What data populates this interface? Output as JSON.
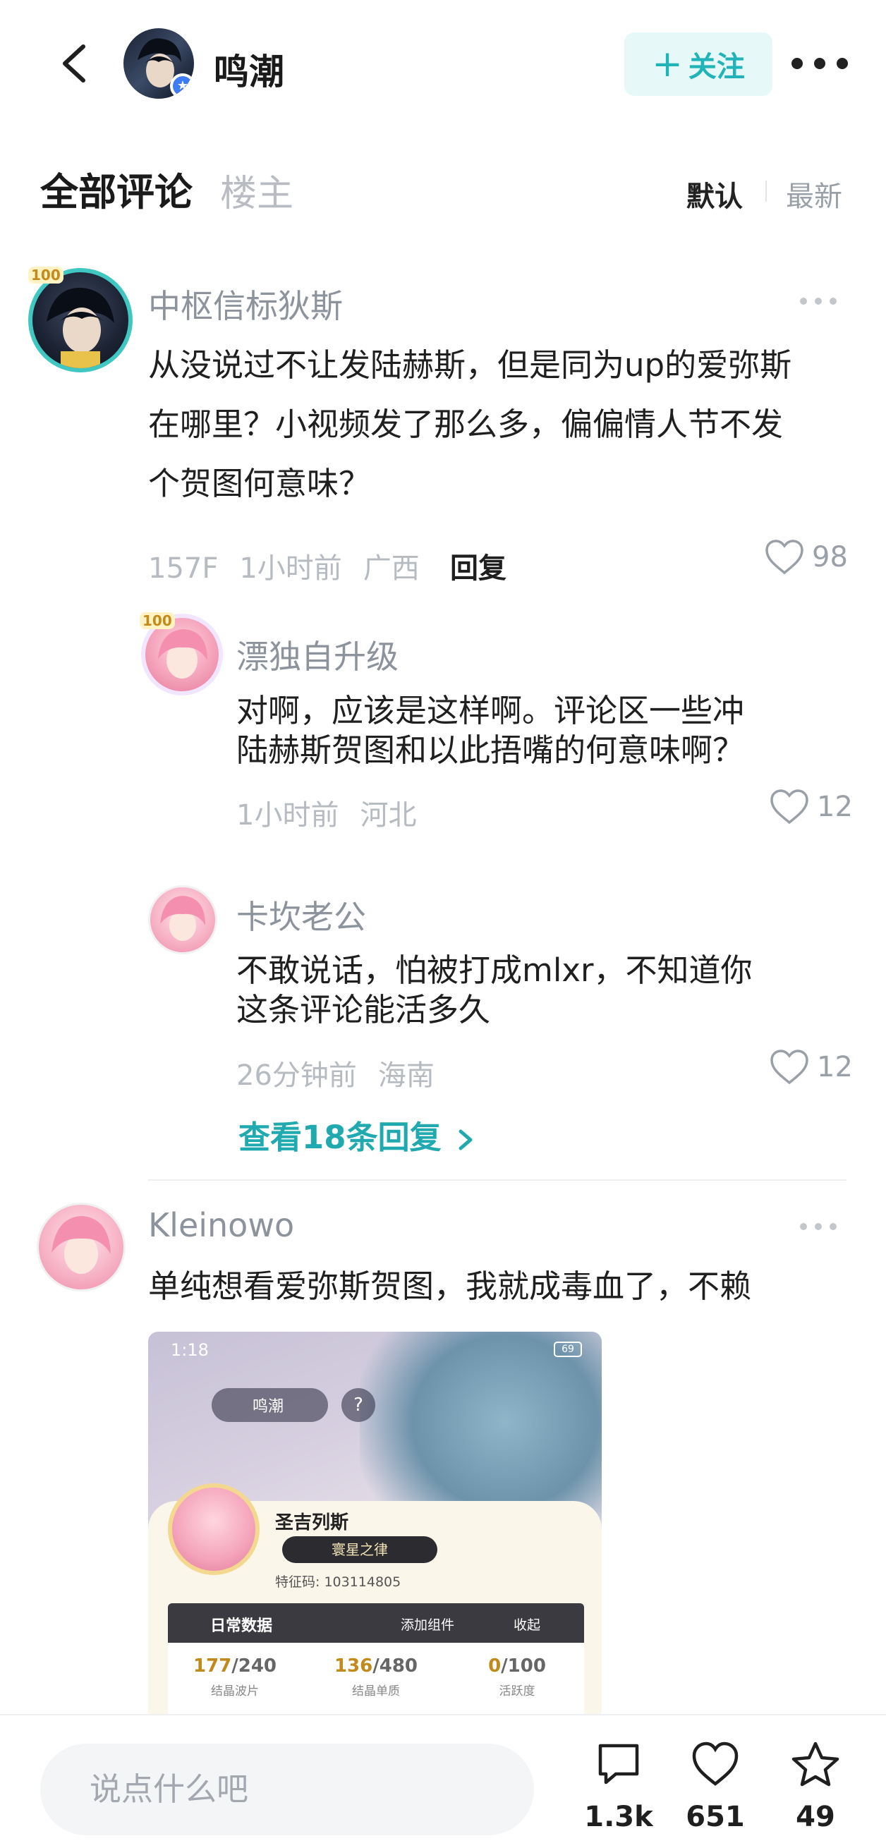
{
  "header": {
    "title": "鸣潮",
    "follow_label": "关注",
    "follow_plus": "+"
  },
  "tabs": {
    "all": "全部评论",
    "op": "楼主",
    "sort_default": "默认",
    "sort_latest": "最新"
  },
  "comment1": {
    "level": "100",
    "username": "中枢信标狄斯",
    "text_line1": "从没说过不让发陆赫斯，但是同为up的爱弥斯",
    "text_line2": "在哪里？小视频发了那么多，偏偏情人节不发",
    "text_line3": "个贺图何意味？",
    "floor": "157F",
    "time": "1小时前",
    "location": "广西",
    "reply_label": "回复",
    "likes": "98"
  },
  "reply1": {
    "level": "100",
    "username": "漂独自升级",
    "text_line1": "对啊，应该是这样啊。评论区一些冲",
    "text_line2": "陆赫斯贺图和以此捂嘴的何意味啊？",
    "time": "1小时前",
    "location": "河北",
    "likes": "12"
  },
  "reply2": {
    "username": "卡坎老公",
    "text_line1": "不敢说话，怕被打成mlxr，不知道你",
    "text_line2": "这条评论能活多久",
    "time": "26分钟前",
    "location": "海南",
    "likes": "12"
  },
  "view_replies": "查看18条回复",
  "comment2": {
    "username": "Kleinowo",
    "text": "单纯想看爱弥斯贺图，我就成毒血了，不赖",
    "screenshot": {
      "time": "1:18",
      "battery": "69",
      "pill_label": "鸣潮",
      "player_name": "圣吉列斯",
      "title_badge": "寰星之律",
      "uid": "特征码: 103114805",
      "section_title": "日常数据",
      "add_widget": "添加组件",
      "collapse": "收起",
      "stats": [
        {
          "value": "177",
          "max": "/240",
          "label": "结晶波片"
        },
        {
          "value": "136",
          "max": "/480",
          "label": "结晶单质"
        },
        {
          "value": "0",
          "max": "/100",
          "label": "活跃度"
        }
      ]
    }
  },
  "bottom": {
    "input_placeholder": "说点什么吧",
    "comments_count": "1.3k",
    "likes_count": "651",
    "favorites_count": "49"
  },
  "colors": {
    "accent": "#20b4b8",
    "follow_bg": "#e6f8f8",
    "muted": "#9aa0a8"
  }
}
